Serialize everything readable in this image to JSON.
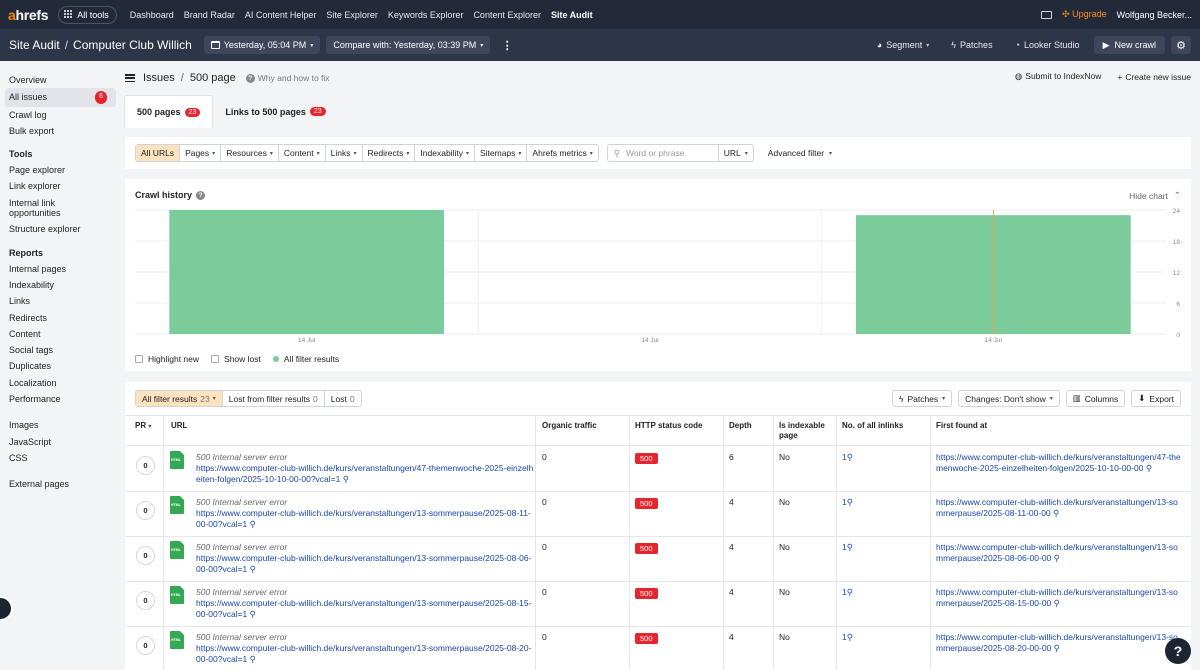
{
  "topnav": {
    "logo": "ahrefs",
    "all_tools": "All tools",
    "links": [
      "Dashboard",
      "Brand Radar",
      "AI Content Helper",
      "Site Explorer",
      "Keywords Explorer",
      "Content Explorer",
      "Site Audit"
    ],
    "active_link": "Site Audit",
    "upgrade": "Upgrade",
    "user": "Wolfgang Becker..."
  },
  "subheader": {
    "section": "Site Audit",
    "project": "Computer Club Willich",
    "date": "Yesterday, 05:04 PM",
    "compare": "Compare with: Yesterday, 03:39 PM",
    "segment": "Segment",
    "patches": "Patches",
    "looker": "Looker Studio",
    "new_crawl": "New crawl"
  },
  "sidebar": {
    "top": [
      {
        "label": "Overview"
      },
      {
        "label": "All issues",
        "badge": "6",
        "active": true
      },
      {
        "label": "Crawl log"
      },
      {
        "label": "Bulk export"
      }
    ],
    "tools_head": "Tools",
    "tools": [
      "Page explorer",
      "Link explorer",
      "Internal link opportunities",
      "Structure explorer"
    ],
    "reports_head": "Reports",
    "reports": [
      "Internal pages",
      "Indexability",
      "Links",
      "Redirects",
      "Content",
      "Social tags",
      "Duplicates",
      "Localization",
      "Performance"
    ],
    "resources": [
      "Images",
      "JavaScript",
      "CSS"
    ],
    "external": "External pages"
  },
  "breadcrumb": {
    "issues": "Issues",
    "page": "500 page",
    "why": "Why and how to fix",
    "submit": "Submit to IndexNow",
    "create": "Create new issue"
  },
  "tabs": [
    {
      "label": "500 pages",
      "count": "23"
    },
    {
      "label": "Links to 500 pages",
      "count": "23"
    }
  ],
  "filters": {
    "buttons": [
      "All URLs",
      "Pages",
      "Resources",
      "Content",
      "Links",
      "Redirects",
      "Indexability",
      "Sitemaps",
      "Ahrefs metrics"
    ],
    "search_placeholder": "Word or phrase",
    "url_select": "URL",
    "advanced": "Advanced filter"
  },
  "chart": {
    "title": "Crawl history",
    "hide": "Hide chart",
    "legend_highlight": "Highlight new",
    "legend_lost": "Show lost",
    "legend_all": "All filter results",
    "x_tick": "14 Jul",
    "y_ticks": [
      "24",
      "18",
      "12",
      "6",
      "0"
    ],
    "bar_color": "#7ccb9a"
  },
  "chart_data": {
    "type": "bar",
    "categories": [
      "14 Jul",
      "14 Jul",
      "14 Jul"
    ],
    "values": [
      24,
      0,
      23
    ],
    "title": "Crawl history",
    "xlabel": "",
    "ylabel": "",
    "ylim": [
      0,
      24
    ],
    "legend": [
      "All filter results"
    ]
  },
  "table": {
    "segments": [
      {
        "label": "All filter results",
        "count": "23"
      },
      {
        "label": "Lost from filter results",
        "count": "0"
      },
      {
        "label": "Lost",
        "count": "0"
      }
    ],
    "patches": "Patches",
    "changes": "Changes: Don't show",
    "columns": "Columns",
    "export": "Export",
    "headers": {
      "pr": "PR",
      "url": "URL",
      "traffic": "Organic traffic",
      "status": "HTTP status code",
      "depth": "Depth",
      "indexable": "Is indexable page",
      "inlinks": "No. of all inlinks",
      "found": "First found at"
    },
    "rows": [
      {
        "pr": "0",
        "error": "500 Internal server error",
        "url": "https://www.computer-club-willich.de/kurs/veranstaltungen/47-themenwoche-2025-einzelheiten-folgen/2025-10-10-00-00?vcal=1",
        "traffic": "0",
        "status": "500",
        "depth": "6",
        "indexable": "No",
        "inlinks": "1",
        "found": "https://www.computer-club-willich.de/kurs/veranstaltungen/47-themenwoche-2025-einzelheiten-folgen/2025-10-10-00-00"
      },
      {
        "pr": "0",
        "error": "500 Internal server error",
        "url": "https://www.computer-club-willich.de/kurs/veranstaltungen/13-sommerpause/2025-08-11-00-00?vcal=1",
        "traffic": "0",
        "status": "500",
        "depth": "4",
        "indexable": "No",
        "inlinks": "1",
        "found": "https://www.computer-club-willich.de/kurs/veranstaltungen/13-sommerpause/2025-08-11-00-00"
      },
      {
        "pr": "0",
        "error": "500 Internal server error",
        "url": "https://www.computer-club-willich.de/kurs/veranstaltungen/13-sommerpause/2025-08-06-00-00?vcal=1",
        "traffic": "0",
        "status": "500",
        "depth": "4",
        "indexable": "No",
        "inlinks": "1",
        "found": "https://www.computer-club-willich.de/kurs/veranstaltungen/13-sommerpause/2025-08-06-00-00"
      },
      {
        "pr": "0",
        "error": "500 Internal server error",
        "url": "https://www.computer-club-willich.de/kurs/veranstaltungen/13-sommerpause/2025-08-15-00-00?vcal=1",
        "traffic": "0",
        "status": "500",
        "depth": "4",
        "indexable": "No",
        "inlinks": "1",
        "found": "https://www.computer-club-willich.de/kurs/veranstaltungen/13-sommerpause/2025-08-15-00-00"
      },
      {
        "pr": "0",
        "error": "500 Internal server error",
        "url": "https://www.computer-club-willich.de/kurs/veranstaltungen/13-sommerpause/2025-08-20-00-00?vcal=1",
        "traffic": "0",
        "status": "500",
        "depth": "4",
        "indexable": "No",
        "inlinks": "1",
        "found": "https://www.computer-club-willich.de/kurs/veranstaltungen/13-sommerpause/2025-08-20-00-00"
      }
    ]
  },
  "help": "?"
}
